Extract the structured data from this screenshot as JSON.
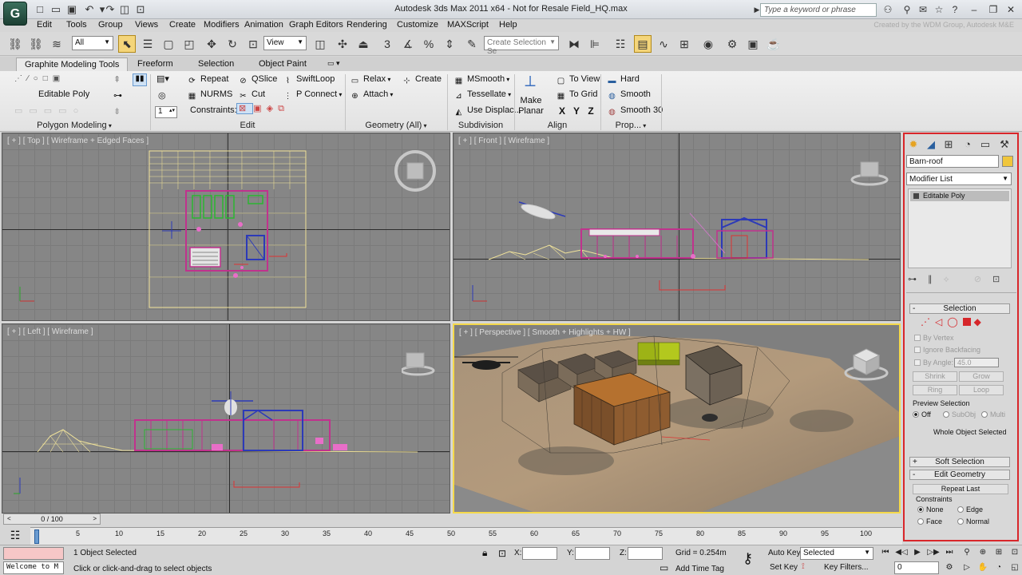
{
  "window": {
    "title": "Autodesk 3ds Max  2011 x64  - Not for Resale  Field_HQ.max",
    "search_placeholder": "Type a keyword or phrase",
    "watermark": "Created by the WDM Group, Autodesk M&E"
  },
  "menu": [
    "Edit",
    "Tools",
    "Group",
    "Views",
    "Create",
    "Modifiers",
    "Animation",
    "Graph Editors",
    "Rendering",
    "Customize",
    "MAXScript",
    "Help"
  ],
  "main_toolbar": {
    "selection_filter": "All",
    "reference_coord": "View",
    "named_selection_placeholder": "Create Selection Se"
  },
  "ribbon": {
    "tabs": [
      "Graphite Modeling Tools",
      "Freeform",
      "Selection",
      "Object Paint"
    ],
    "editable_poly": "Editable Poly",
    "edit": {
      "repeat": "Repeat",
      "qslice": "QSlice",
      "swiftloop": "SwiftLoop",
      "nurms": "NURMS",
      "cut": "Cut",
      "pconnect": "P Connect",
      "constraints_label": "Constraints:",
      "spinner_value": "1"
    },
    "geometry": {
      "relax": "Relax",
      "create": "Create",
      "attach": "Attach"
    },
    "subdivision": {
      "msmooth": "MSmooth",
      "tessellate": "Tessellate",
      "use_displac": "Use Displac..."
    },
    "align": {
      "make_planar": "Make\nPlanar",
      "to_view": "To View",
      "to_grid": "To Grid",
      "x": "X",
      "y": "Y",
      "z": "Z"
    },
    "properties": {
      "hard": "Hard",
      "smooth": "Smooth",
      "smooth30": "Smooth 30"
    },
    "group_captions": {
      "polygon_modeling": "Polygon Modeling",
      "edit": "Edit",
      "geometry": "Geometry (All)",
      "subdivision": "Subdivision",
      "align": "Align",
      "properties": "Prop..."
    }
  },
  "viewports": {
    "top": "[ + ] [ Top ] [ Wireframe + Edged Faces ]",
    "front": "[ + ] [ Front ] [ Wireframe ]",
    "left": "[ + ] [ Left ] [ Wireframe ]",
    "perspective": "[ + ] [ Perspective ] [ Smooth + Highlights + HW ]"
  },
  "command_panel": {
    "object_name": "Barn-roof",
    "modifier_list": "Modifier List",
    "stack_item": "Editable Poly",
    "selection_rollout": "Selection",
    "by_vertex": "By Vertex",
    "ignore_backfacing": "Ignore Backfacing",
    "by_angle": "By Angle:",
    "angle_value": "45.0",
    "shrink": "Shrink",
    "grow": "Grow",
    "ring": "Ring",
    "loop": "Loop",
    "preview_selection": "Preview Selection",
    "preview_off": "Off",
    "preview_subobj": "SubObj",
    "preview_multi": "Multi",
    "whole_object_selected": "Whole Object Selected",
    "soft_selection": "Soft Selection",
    "edit_geometry": "Edit Geometry",
    "repeat_last": "Repeat Last",
    "constraints": "Constraints",
    "none": "None",
    "edge": "Edge",
    "face": "Face",
    "normal": "Normal",
    "colors": {
      "object_color": "#f0c63c",
      "panel_border": "#d9262a"
    }
  },
  "timeline": {
    "frame_counter": "0 / 100",
    "ticks": [
      "0",
      "5",
      "10",
      "15",
      "20",
      "25",
      "30",
      "35",
      "40",
      "45",
      "50",
      "55",
      "60",
      "65",
      "70",
      "75",
      "80",
      "85",
      "90",
      "95",
      "100"
    ]
  },
  "statusbar": {
    "listener": "Welcome to M",
    "objects_selected": "1 Object Selected",
    "prompt": "Click or click-and-drag to select objects",
    "x_label": "X:",
    "y_label": "Y:",
    "z_label": "Z:",
    "grid": "Grid = 0.254m",
    "add_time_tag": "Add Time Tag",
    "auto_key": "Auto Key",
    "set_key": "Set Key",
    "selected": "Selected",
    "key_filters": "Key Filters...",
    "frame_value": "0"
  }
}
